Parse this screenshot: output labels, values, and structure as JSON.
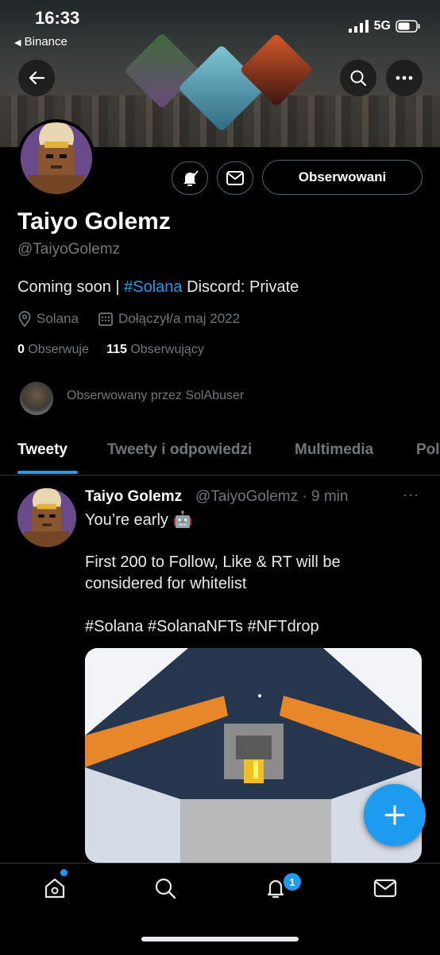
{
  "status_bar": {
    "time": "16:33",
    "back_app": "Binance",
    "network": "5G"
  },
  "profile": {
    "name": "Taiyo Golemz",
    "handle": "@TaiyoGolemz",
    "follow_button": "Obserwowani",
    "bio_prefix": "Coming soon | ",
    "bio_hashtag": "#Solana",
    "bio_suffix": " Discord: Private",
    "location": "Solana",
    "joined": "Dołączył/a maj 2022",
    "following_count": "0",
    "following_label": "Obserwuje",
    "followers_count": "115",
    "followers_label": "Obserwujący",
    "followed_by": "Obserwowany przez SolAbuser"
  },
  "tabs": [
    {
      "label": "Tweety"
    },
    {
      "label": "Tweety i odpowiedzi"
    },
    {
      "label": "Multimedia"
    },
    {
      "label": "Pol"
    }
  ],
  "tweet": {
    "author": "Taiyo Golemz",
    "meta": "@TaiyoGolemz · 9 min",
    "more": "···",
    "line1": "You’re early 🤖",
    "line2": "First 200 to Follow, Like & RT will be",
    "line3": "considered for whitelist",
    "hashtags": "#Solana #SolanaNFTs #NFTdrop"
  },
  "bottom_nav": {
    "notification_badge": "1"
  },
  "colors": {
    "accent": "#1d9bf0",
    "background": "#000000",
    "muted": "#71767b"
  }
}
